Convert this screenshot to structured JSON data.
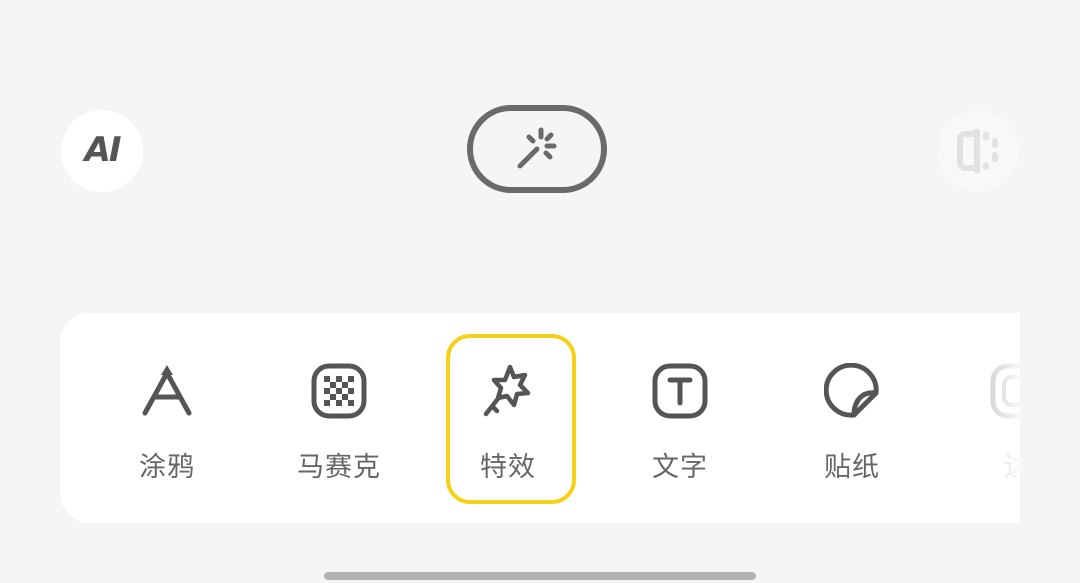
{
  "top": {
    "ai_label": "AI"
  },
  "tools": [
    {
      "label": "涂鸦",
      "icon": "doodle-icon",
      "selected": false
    },
    {
      "label": "马赛克",
      "icon": "mosaic-icon",
      "selected": false
    },
    {
      "label": "特效",
      "icon": "effect-wand-icon",
      "selected": true
    },
    {
      "label": "文字",
      "icon": "text-icon",
      "selected": false
    },
    {
      "label": "贴纸",
      "icon": "sticker-icon",
      "selected": false
    },
    {
      "label": "边",
      "icon": "border-icon",
      "selected": false
    }
  ],
  "colors": {
    "selected_border": "#f5d21a",
    "icon": "#555555",
    "label": "#666666",
    "background": "#f5f5f5",
    "panel": "#ffffff"
  }
}
